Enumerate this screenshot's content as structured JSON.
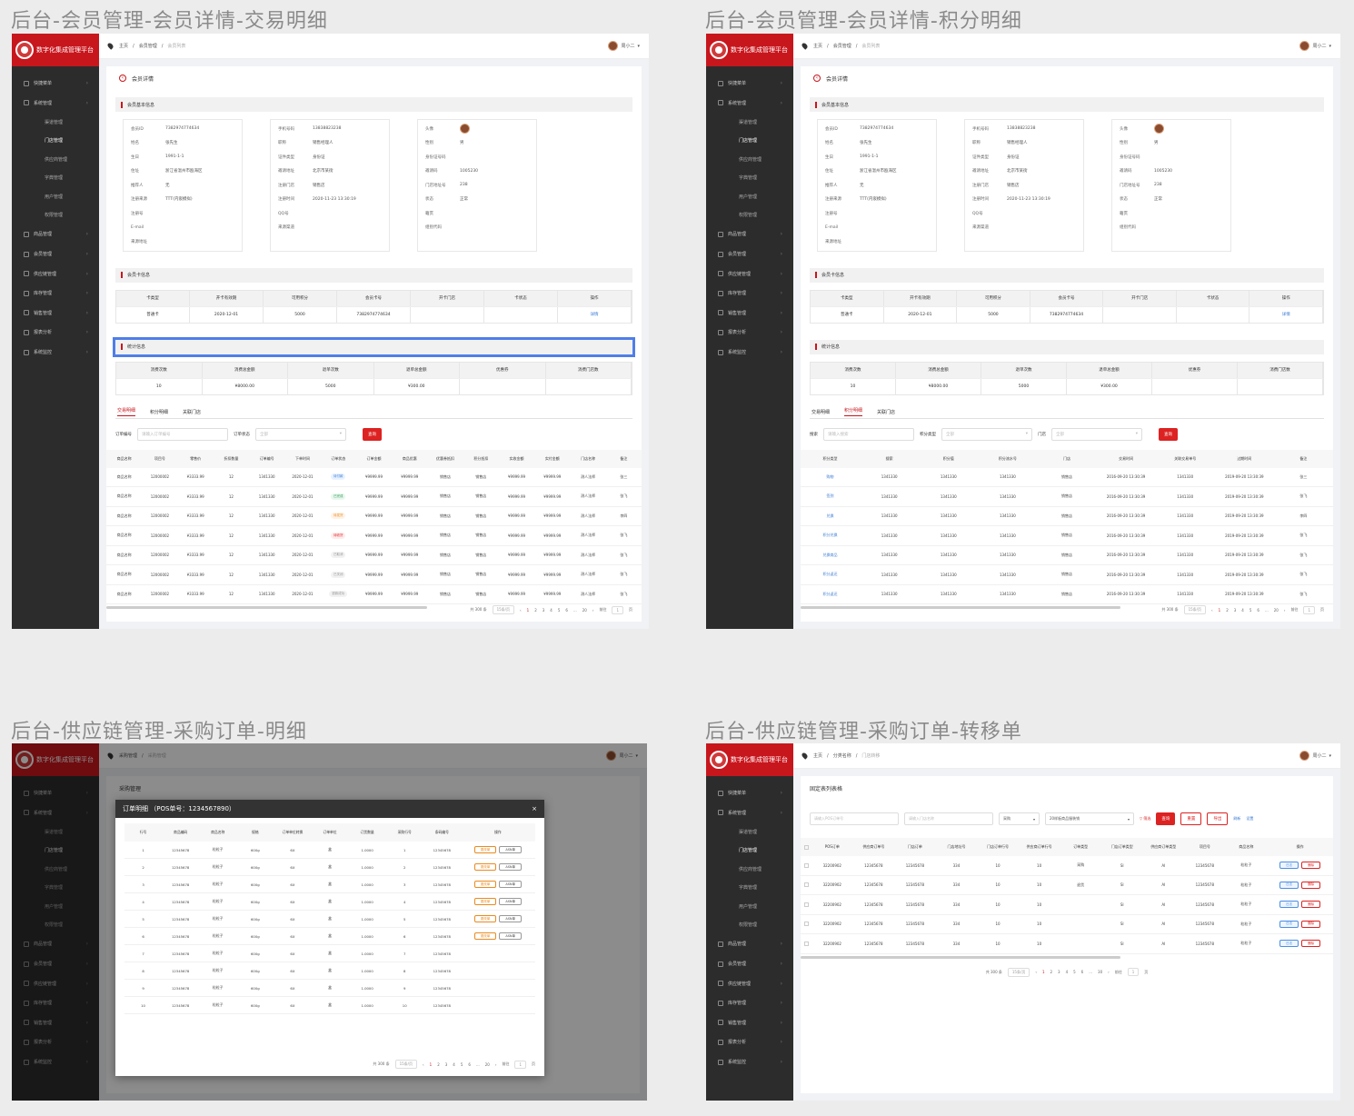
{
  "pages": {
    "p1_title": "后台-会员管理-会员详情-交易明细",
    "p2_title": "后台-会员管理-会员详情-积分明细",
    "p3_title": "后台-供应链管理-采购订单-明细",
    "p4_title": "后台-供应链管理-采购订单-转移单"
  },
  "app": {
    "name": "数字化集成管理平台",
    "user": "周小二"
  },
  "menu": {
    "dashboard": "快捷菜单",
    "system": "系统管理",
    "sub": [
      "渠道管理",
      "门店管理",
      "供应商管理",
      "字典管理",
      "用户管理",
      "权限管理"
    ],
    "goods": "商品管理",
    "member": "会员管理",
    "supply": "供应链管理",
    "stock": "库存管理",
    "sales": "销售管理",
    "report": "报表分析",
    "monitor": "系统监控"
  },
  "breadcrumb": {
    "home": "主页",
    "member_mgmt": "会员管理",
    "member_list": "会员列表",
    "supply": "采购管理",
    "supply_list": "采购管理",
    "dist": "分类名称",
    "dist_list": "门店转移"
  },
  "detail": {
    "page_title": "会员详情",
    "base_section": "会员基本信息",
    "card_section": "会员卡信息",
    "stat_section": "统计信息",
    "col1": [
      [
        "会员ID",
        "7382974774634"
      ],
      [
        "姓名",
        "张先生"
      ],
      [
        "生日",
        "1991-1-1"
      ],
      [
        "住址",
        "浙江省温州市瓯海区"
      ],
      [
        "推荐人",
        "无"
      ],
      [
        "注册来源",
        "TTT(内嵌模拟)"
      ],
      [
        "注册号",
        ""
      ],
      [
        "E-mail",
        ""
      ],
      [
        "来源地址",
        ""
      ]
    ],
    "col2": [
      [
        "手机号码",
        "13838823238"
      ],
      [
        "职称",
        "销售经理人"
      ],
      [
        "证件类型",
        "身份证"
      ],
      [
        "邀请地址",
        "北京市某街"
      ],
      [
        "注册门店",
        "销售店"
      ],
      [
        "注册时间",
        "2020-11-23 13:30:19"
      ],
      [
        "QQ号",
        ""
      ],
      [
        "来源渠道",
        ""
      ]
    ],
    "col3": [
      [
        "头像",
        ""
      ],
      [
        "性别",
        "男"
      ],
      [
        "身份证号码",
        ""
      ],
      [
        "邀请码",
        "1005230"
      ],
      [
        "门店地址号",
        "238"
      ],
      [
        "状态",
        "正常"
      ],
      [
        "籍贯",
        ""
      ],
      [
        "组别代码",
        ""
      ]
    ],
    "card_headers": [
      "卡类型",
      "开卡有效期",
      "可用积分",
      "会员卡号",
      "开卡门店",
      "卡状态",
      "操作"
    ],
    "card_row": [
      "普通卡",
      "2020-12-01",
      "5000",
      "7382974774634",
      "",
      "",
      "详情"
    ],
    "stat_headers": [
      "消费次数",
      "消费总金额",
      "退单次数",
      "退单总金额",
      "优惠券",
      "消费门店数"
    ],
    "stat_row": [
      "10",
      "¥8000.00",
      "5000",
      "¥300.00",
      "",
      ""
    ],
    "tabs": [
      "交易明细",
      "积分明细",
      "关联门店"
    ],
    "filter_order": "订单编号",
    "filter_order_ph": "请输入订单编号",
    "filter_status": "订单状态",
    "filter_all": "全部",
    "search": "查询",
    "tx_headers": [
      "商品名称",
      "项目号",
      "零售价",
      "折扣数量",
      "订单编号",
      "下单时间",
      "订单状态",
      "订单金额",
      "商品优惠",
      "优惠券抵扣",
      "积分抵扣",
      "实收金额",
      "实付金额",
      "门店名称",
      "备注"
    ],
    "tx_rows": [
      [
        "商品名称",
        "12000002",
        "¥3333.99",
        "12",
        "1341330",
        "2020-12-01",
        "待付款",
        "¥9999.99",
        "¥9999.99",
        "销售店",
        "销售店",
        "¥9999.99",
        "¥9999.99",
        "测人法师",
        "张三"
      ],
      [
        "商品名称",
        "12000002",
        "¥3333.99",
        "12",
        "1341330",
        "2020-12-01",
        "已完成",
        "¥9999.99",
        "¥9999.99",
        "销售店",
        "销售店",
        "¥9999.99",
        "¥9999.99",
        "测人法师",
        "张飞"
      ],
      [
        "商品名称",
        "12000002",
        "¥3333.99",
        "12",
        "1341330",
        "2020-12-01",
        "待发货",
        "¥9999.99",
        "¥9999.99",
        "销售店",
        "销售店",
        "¥9999.99",
        "¥9999.99",
        "测人法师",
        "李四"
      ],
      [
        "商品名称",
        "12000002",
        "¥3333.99",
        "12",
        "1341330",
        "2020-12-01",
        "待收货",
        "¥9999.99",
        "¥9999.99",
        "销售店",
        "销售店",
        "¥9999.99",
        "¥9999.99",
        "测人法师",
        "张飞"
      ],
      [
        "商品名称",
        "12000002",
        "¥3333.99",
        "12",
        "1341330",
        "2020-12-01",
        "已取消",
        "¥9999.99",
        "¥9999.99",
        "销售店",
        "销售店",
        "¥9999.99",
        "¥9999.99",
        "测人法师",
        "张飞"
      ],
      [
        "商品名称",
        "12000002",
        "¥3333.99",
        "12",
        "1341330",
        "2020-12-01",
        "已关闭",
        "¥9999.99",
        "¥9999.99",
        "销售店",
        "销售店",
        "¥9999.99",
        "¥9999.99",
        "测人法师",
        "张飞"
      ],
      [
        "商品名称",
        "12000002",
        "¥3333.99",
        "12",
        "1341330",
        "2020-12-01",
        "退款成功",
        "¥9999.99",
        "¥9999.99",
        "销售店",
        "销售店",
        "¥9999.99",
        "¥9999.99",
        "测人法师",
        "张飞"
      ]
    ],
    "pt_filter_type": "积分类型",
    "pt_filter_ph": "请输入搜索",
    "pt_filter_label": "搜索",
    "pt_filter_store": "门店",
    "pt_headers": [
      "积分类型",
      "搜索",
      "积分值",
      "积分流水号",
      "门店",
      "交易时间",
      "关联交易单号",
      "过期时间",
      "备注"
    ],
    "pt_rows": [
      [
        "购物",
        "1341330",
        "1341330",
        "1341330",
        "销售店",
        "2016-09-20 13:30:39",
        "1341330",
        "2019-09-20 13:30:39",
        "张三"
      ],
      [
        "签到",
        "1341330",
        "1341330",
        "1341330",
        "销售店",
        "2016-09-20 13:30:39",
        "1341330",
        "2019-09-20 13:30:39",
        "张飞"
      ],
      [
        "兑换",
        "1341330",
        "1341330",
        "1341330",
        "销售店",
        "2016-09-20 13:30:39",
        "1341330",
        "2019-09-20 13:30:39",
        "李四"
      ],
      [
        "积分兑换",
        "1341330",
        "1341330",
        "1341330",
        "销售店",
        "2016-09-20 13:30:39",
        "1341330",
        "2019-09-20 13:30:39",
        "张飞"
      ],
      [
        "兑换商品",
        "1341330",
        "1341330",
        "1341330",
        "销售店",
        "2016-09-20 13:30:39",
        "1341330",
        "2019-09-20 13:30:39",
        "张飞"
      ],
      [
        "积分返还",
        "1341330",
        "1341330",
        "1341330",
        "销售店",
        "2016-09-20 13:30:39",
        "1341330",
        "2019-09-20 13:30:39",
        "张飞"
      ],
      [
        "积分返还",
        "1341330",
        "1341330",
        "1341330",
        "销售店",
        "2016-09-20 13:30:39",
        "1341330",
        "2019-09-20 13:30:39",
        "张飞"
      ]
    ]
  },
  "pager": {
    "total": "共 300 条",
    "size": "15条/页",
    "pages": [
      "1",
      "2",
      "3",
      "4",
      "5",
      "6",
      "...",
      "20"
    ],
    "goto": "前往",
    "page": "1",
    "unit": "页",
    "last": "30"
  },
  "purchase": {
    "list_title": "采购管理",
    "modal_title": "订单明细 （POS单号：1234567890）",
    "headers": [
      "行号",
      "商品编码",
      "商品名称",
      "规格",
      "订单单位转换",
      "订单单位",
      "订货数量",
      "采购行号",
      "条码编号",
      "操作"
    ],
    "rows": [
      [
        "1",
        "12345678",
        "粒粒子",
        "600g",
        "6X",
        "盒",
        "1.0000",
        "1",
        "12345678"
      ],
      [
        "2",
        "12345678",
        "粒粒子",
        "600g",
        "6X",
        "盒",
        "1.0000",
        "2",
        "12345678"
      ],
      [
        "3",
        "12345678",
        "粒粒子",
        "600g",
        "6X",
        "盒",
        "1.0000",
        "3",
        "12345678"
      ],
      [
        "4",
        "12345678",
        "粒粒子",
        "600g",
        "6X",
        "盒",
        "1.0000",
        "4",
        "12345678"
      ],
      [
        "5",
        "12345678",
        "粒粒子",
        "600g",
        "6X",
        "盒",
        "1.0000",
        "5",
        "12345678"
      ],
      [
        "6",
        "12345678",
        "粒粒子",
        "600g",
        "6X",
        "盒",
        "1.0000",
        "6",
        "12345678"
      ],
      [
        "7",
        "12345678",
        "粒粒子",
        "600g",
        "6X",
        "盒",
        "1.0000",
        "7",
        "12345678"
      ],
      [
        "8",
        "12345678",
        "粒粒子",
        "600g",
        "6X",
        "盒",
        "1.0000",
        "8",
        "12345678"
      ],
      [
        "9",
        "12345678",
        "粒粒子",
        "600g",
        "6X",
        "盒",
        "1.0000",
        "9",
        "12345678"
      ],
      [
        "10",
        "12345678",
        "粒粒子",
        "600g",
        "6X",
        "盒",
        "1.0000",
        "10",
        "12345678"
      ]
    ],
    "op_edit": "更改单",
    "op_view": "ASN单"
  },
  "transfer": {
    "title": "固定表列表格",
    "ph1": "请输入POS订单号",
    "ph2": "请输入门店名称",
    "sel1": "采购",
    "sel2": "20样板商品服装销",
    "filter": "筛选",
    "btn_search": "查询",
    "btn_reset": "重置",
    "btn_export": "导出",
    "refresh": "刷新",
    "setting": "设置",
    "headers": [
      "POS订单",
      "供应商订单号",
      "门店订单",
      "门店地址号",
      "门店订单行号",
      "供应商订单行号",
      "订单类型",
      "门店订单类型",
      "供应商订单类型",
      "项目号",
      "商品名称",
      "操作"
    ],
    "rows": [
      [
        "32200902",
        "12345678",
        "12345678",
        "334",
        "10",
        "10",
        "采购",
        "SI",
        "AI",
        "12345678",
        "粒粒子"
      ],
      [
        "32200902",
        "12345678",
        "12345678",
        "334",
        "10",
        "10",
        "退货",
        "SI",
        "AI",
        "12345678",
        "粒粒子"
      ],
      [
        "32200902",
        "12345678",
        "12345678",
        "334",
        "10",
        "10",
        "",
        "SI",
        "AI",
        "12345678",
        "粒粒子"
      ],
      [
        "32200902",
        "12345678",
        "12345678",
        "334",
        "10",
        "10",
        "",
        "SI",
        "AI",
        "12345678",
        "粒粒子"
      ],
      [
        "32200902",
        "12345678",
        "12345678",
        "334",
        "10",
        "10",
        "",
        "SI",
        "AI",
        "12345678",
        "粒粒子"
      ]
    ],
    "op1": "日志",
    "op2": "删除"
  }
}
